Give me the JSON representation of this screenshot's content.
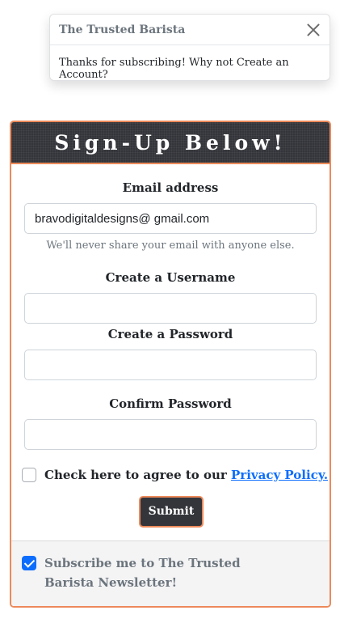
{
  "toast": {
    "title": "The Trusted Barista",
    "message": "Thanks for subscribing! Why not Create an Account?"
  },
  "card": {
    "title": "Sign-Up Below!",
    "email": {
      "label": "Email address",
      "value": "bravodigitaldesigns@ gmail.com",
      "help": "We'll never share your email with anyone else."
    },
    "username": {
      "label": "Create a Username",
      "value": ""
    },
    "password": {
      "label": "Create a Password",
      "value": ""
    },
    "confirm": {
      "label": "Confirm Password",
      "value": ""
    },
    "agree": {
      "text": "Check here to agree to our ",
      "link": "Privacy Policy.",
      "checked": false
    },
    "submit_label": "Submit",
    "newsletter": {
      "text": "Subscribe me to The Trusted Barista Newsletter!",
      "checked": true
    }
  },
  "colors": {
    "accent": "#ec8a5a",
    "header_bg": "#34353a",
    "link": "#0d6efd",
    "muted": "#6c757d"
  }
}
